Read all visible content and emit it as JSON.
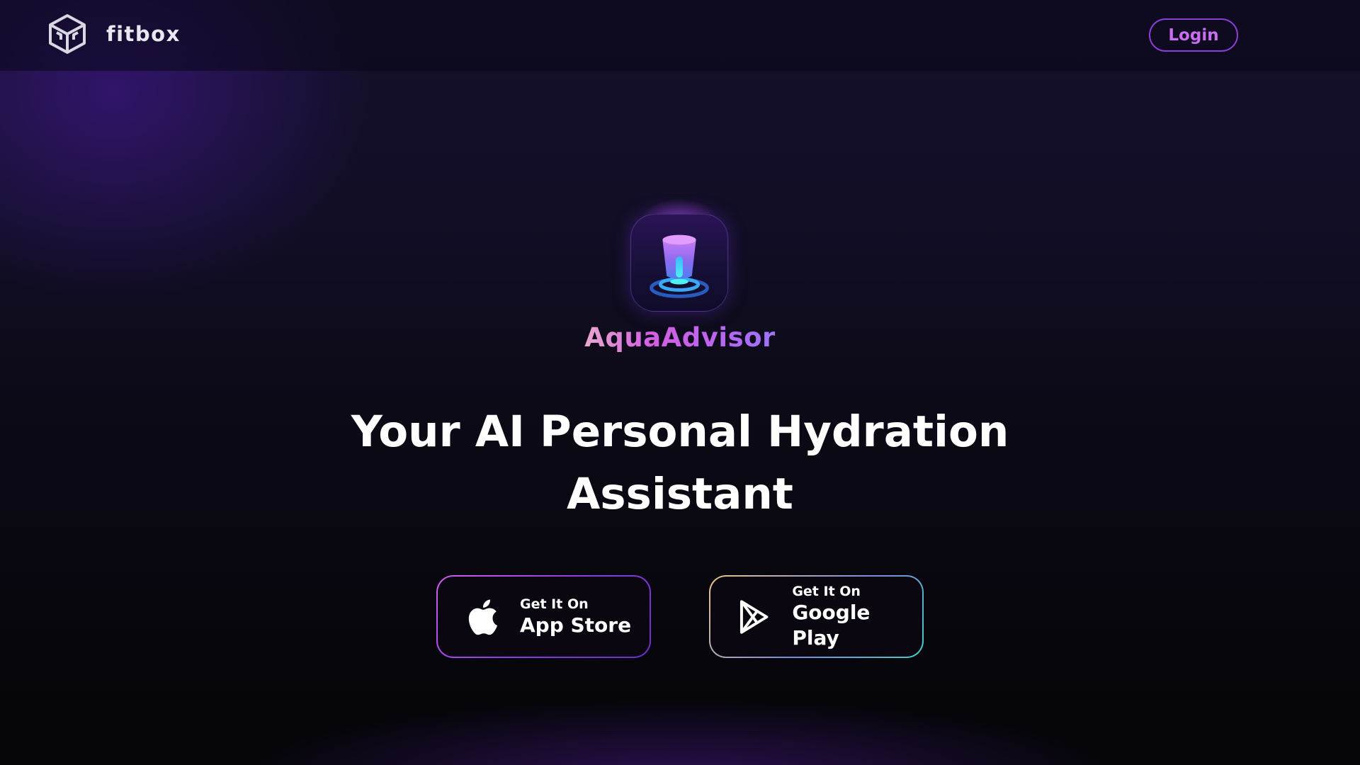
{
  "header": {
    "brand_name": "fitbox",
    "login_label": "Login"
  },
  "app": {
    "name": "AquaAdvisor",
    "headline_line1": "Your AI Personal Hydration",
    "headline_line2": "Assistant"
  },
  "downloads": {
    "app_store": {
      "small": "Get It On",
      "big": "App Store"
    },
    "google_play": {
      "small": "Get It On",
      "big": "Google Play"
    }
  },
  "colors": {
    "accent_purple": "#8a3fd6",
    "login_text": "#c96ef0",
    "background_dark": "#0b0914",
    "water_cyan": "#3fd0e8"
  },
  "icons": {
    "brand": "cube-logo-icon",
    "app": "water-cup-icon",
    "app_store": "apple-icon",
    "google_play": "play-store-icon"
  }
}
